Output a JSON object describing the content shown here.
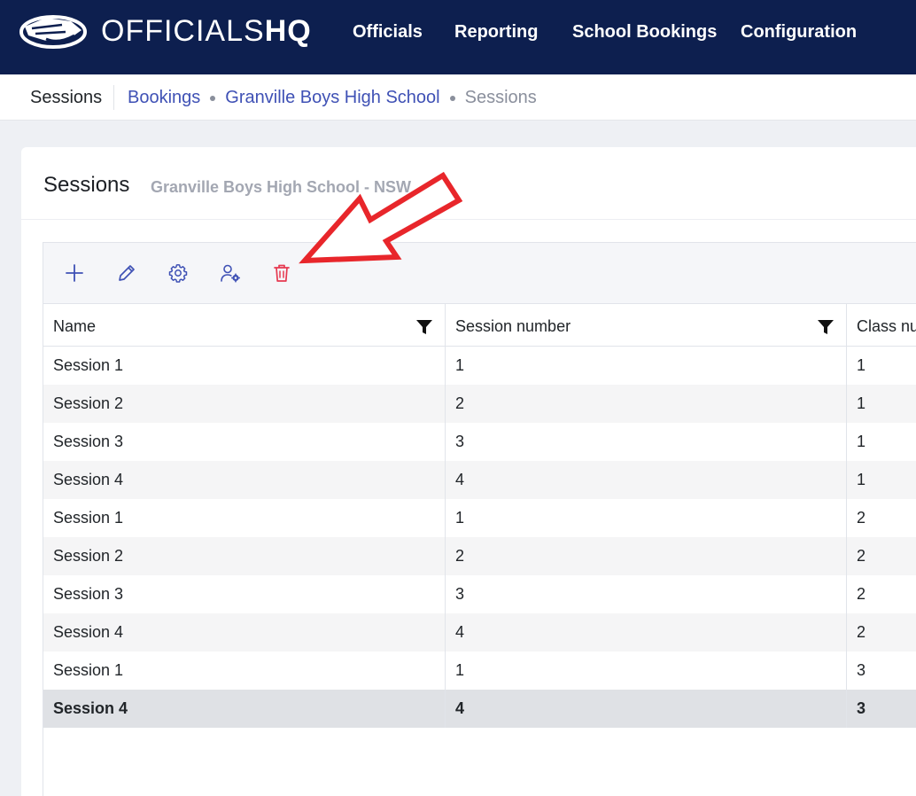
{
  "app": {
    "brand_light": "OFFICIALS",
    "brand_bold": "HQ"
  },
  "nav": {
    "items": [
      {
        "label": "Officials"
      },
      {
        "label": "Reporting"
      },
      {
        "label": "School Bookings"
      },
      {
        "label": "Configuration"
      }
    ]
  },
  "subheader": {
    "title": "Sessions",
    "breadcrumb": [
      {
        "label": "Bookings"
      },
      {
        "label": "Granville Boys High School"
      },
      {
        "label": "Sessions"
      }
    ]
  },
  "card": {
    "title": "Sessions",
    "subtitle": "Granville Boys High School - NSW"
  },
  "toolbar": {
    "buttons": [
      {
        "icon": "plus-icon"
      },
      {
        "icon": "pencil-icon"
      },
      {
        "icon": "gear-icon"
      },
      {
        "icon": "user-settings-icon"
      },
      {
        "icon": "trash-icon"
      }
    ]
  },
  "table": {
    "columns": [
      "Name",
      "Session number",
      "Class number"
    ],
    "rows": [
      {
        "name": "Session 1",
        "session": "1",
        "class": "1"
      },
      {
        "name": "Session 2",
        "session": "2",
        "class": "1"
      },
      {
        "name": "Session 3",
        "session": "3",
        "class": "1"
      },
      {
        "name": "Session 4",
        "session": "4",
        "class": "1"
      },
      {
        "name": "Session 1",
        "session": "1",
        "class": "2"
      },
      {
        "name": "Session 2",
        "session": "2",
        "class": "2"
      },
      {
        "name": "Session 3",
        "session": "3",
        "class": "2"
      },
      {
        "name": "Session 4",
        "session": "4",
        "class": "2"
      },
      {
        "name": "Session 1",
        "session": "1",
        "class": "3"
      },
      {
        "name": "Session 4",
        "session": "4",
        "class": "3"
      }
    ],
    "selected_row": 9
  },
  "colors": {
    "nav_bg": "#0d1f4f",
    "link": "#3f51b5",
    "toolbar_icon": "#3f51b5",
    "delete_icon": "#e63950",
    "annotation_arrow": "#e8262b"
  }
}
